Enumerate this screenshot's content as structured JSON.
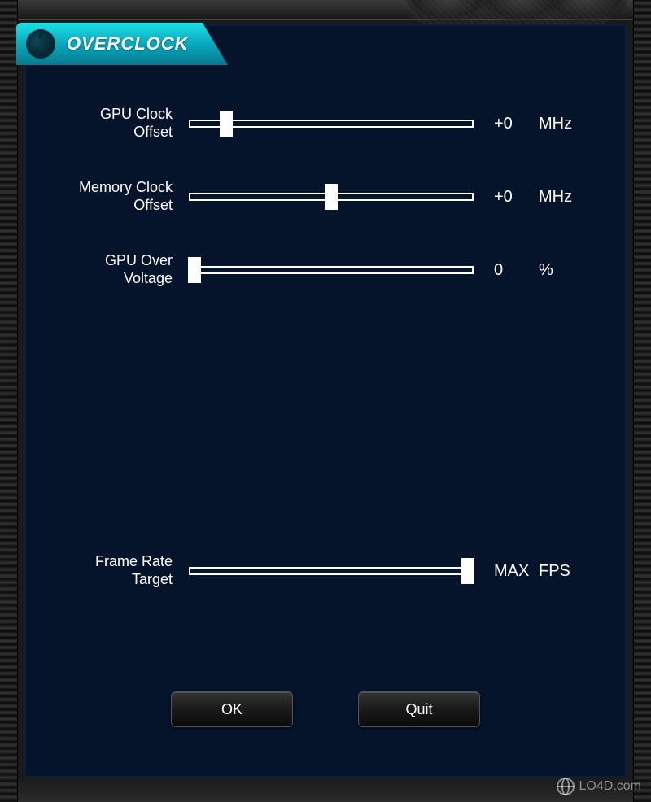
{
  "title": "OVERCLOCK",
  "sliders": {
    "gpu_clock": {
      "label": "GPU Clock Offset",
      "value": "+0",
      "unit": "MHz",
      "position": 13
    },
    "memory_clock": {
      "label": "Memory Clock Offset",
      "value": "+0",
      "unit": "MHz",
      "position": 50
    },
    "gpu_voltage": {
      "label": "GPU Over Voltage",
      "value": "0",
      "unit": "%",
      "position": 2
    },
    "frame_rate": {
      "label": "Frame Rate Target",
      "value": "MAX",
      "unit": "FPS",
      "position": 98
    }
  },
  "buttons": {
    "ok": "OK",
    "quit": "Quit"
  },
  "watermark": "LO4D.com"
}
